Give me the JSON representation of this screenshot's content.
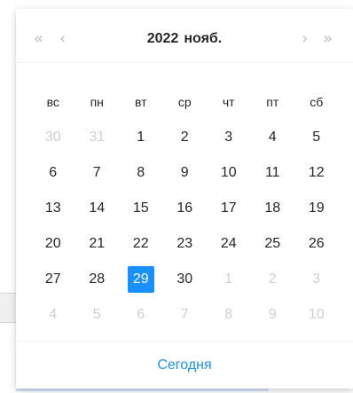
{
  "header": {
    "super_prev": "«",
    "prev": "‹",
    "next": "›",
    "super_next": "»",
    "year": "2022",
    "month": "нояб."
  },
  "weekdays": [
    "вс",
    "пн",
    "вт",
    "ср",
    "чт",
    "пт",
    "сб"
  ],
  "weeks": [
    [
      {
        "d": "30",
        "out": true
      },
      {
        "d": "31",
        "out": true
      },
      {
        "d": "1"
      },
      {
        "d": "2"
      },
      {
        "d": "3"
      },
      {
        "d": "4"
      },
      {
        "d": "5"
      }
    ],
    [
      {
        "d": "6"
      },
      {
        "d": "7"
      },
      {
        "d": "8"
      },
      {
        "d": "9"
      },
      {
        "d": "10"
      },
      {
        "d": "11"
      },
      {
        "d": "12"
      }
    ],
    [
      {
        "d": "13"
      },
      {
        "d": "14"
      },
      {
        "d": "15"
      },
      {
        "d": "16"
      },
      {
        "d": "17"
      },
      {
        "d": "18"
      },
      {
        "d": "19"
      }
    ],
    [
      {
        "d": "20"
      },
      {
        "d": "21"
      },
      {
        "d": "22"
      },
      {
        "d": "23"
      },
      {
        "d": "24"
      },
      {
        "d": "25"
      },
      {
        "d": "26"
      }
    ],
    [
      {
        "d": "27"
      },
      {
        "d": "28"
      },
      {
        "d": "29",
        "selected": true
      },
      {
        "d": "30"
      },
      {
        "d": "1",
        "out": true
      },
      {
        "d": "2",
        "out": true
      },
      {
        "d": "3",
        "out": true
      }
    ],
    [
      {
        "d": "4",
        "out": true
      },
      {
        "d": "5",
        "out": true
      },
      {
        "d": "6",
        "out": true
      },
      {
        "d": "7",
        "out": true
      },
      {
        "d": "8",
        "out": true
      },
      {
        "d": "9",
        "out": true
      },
      {
        "d": "10",
        "out": true
      }
    ]
  ],
  "footer": {
    "today_label": "Сегодня"
  },
  "colors": {
    "accent": "#1890ff",
    "muted": "#cfcfcf",
    "text": "#262626"
  }
}
